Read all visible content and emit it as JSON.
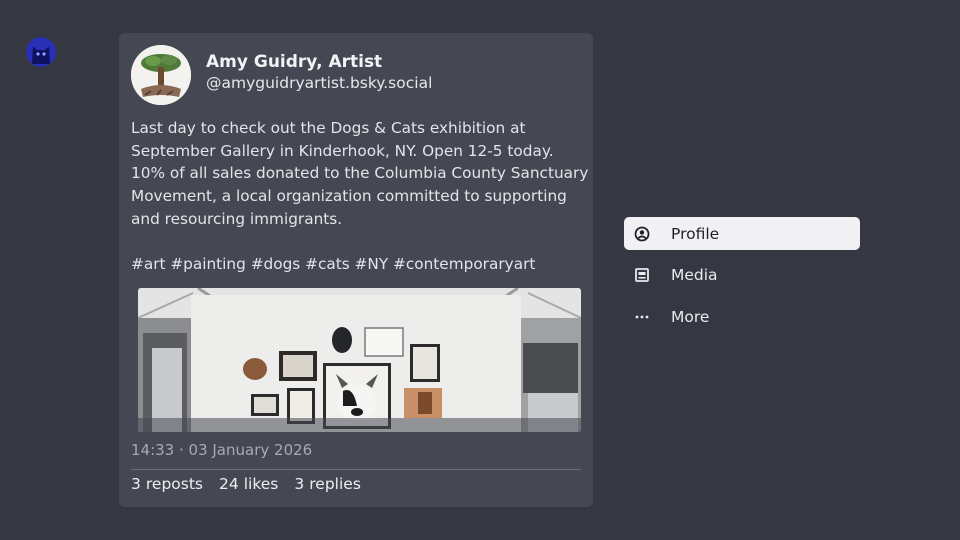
{
  "app": {
    "avatar_icon": "cat-avatar-icon"
  },
  "post": {
    "author_name": "Amy Guidry, Artist",
    "author_handle": "@amyguidryartist.bsky.social",
    "text_lines": [
      "Last day to check out the Dogs & Cats exhibition at",
      "September Gallery in Kinderhook, NY. Open 12-5 today.",
      "10% of all sales donated to the Columbia County Sanctuary",
      "Movement, a local organization committed to supporting",
      "and resourcing immigrants."
    ],
    "hashtags": "#art #painting #dogs #cats #NY #contemporaryart",
    "timestamp": "14:33 · 03 January 2026",
    "stats": {
      "reposts_count": "3",
      "reposts_label": "reposts",
      "likes_count": "24",
      "likes_label": "likes",
      "replies_count": "3",
      "replies_label": "replies"
    }
  },
  "menu": {
    "items": [
      {
        "label": "Profile",
        "icon": "profile-icon",
        "active": true
      },
      {
        "label": "Media",
        "icon": "media-icon",
        "active": false
      },
      {
        "label": "More",
        "icon": "more-icon",
        "active": false
      }
    ]
  },
  "colors": {
    "background": "#353842",
    "card": "#454852",
    "menu_active": "#f1f1f4"
  }
}
